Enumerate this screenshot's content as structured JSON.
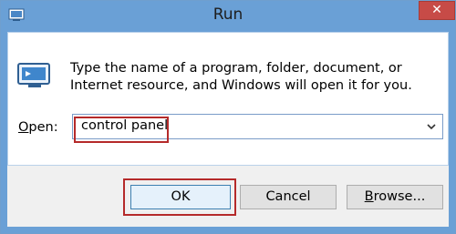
{
  "window": {
    "title": "Run",
    "close_glyph": "✕",
    "icon": "run-icon"
  },
  "content": {
    "description": "Type the name of a program, folder, document, or Internet resource, and Windows will open it for you.",
    "open_label_accel": "O",
    "open_label_rest": "pen:",
    "open_value": "control panel"
  },
  "buttons": {
    "ok": "OK",
    "cancel": "Cancel",
    "browse_accel": "B",
    "browse_rest": "rowse..."
  },
  "colors": {
    "titlebar": "#6aa0d6",
    "close": "#c74b47",
    "highlight": "#b52a2a"
  }
}
